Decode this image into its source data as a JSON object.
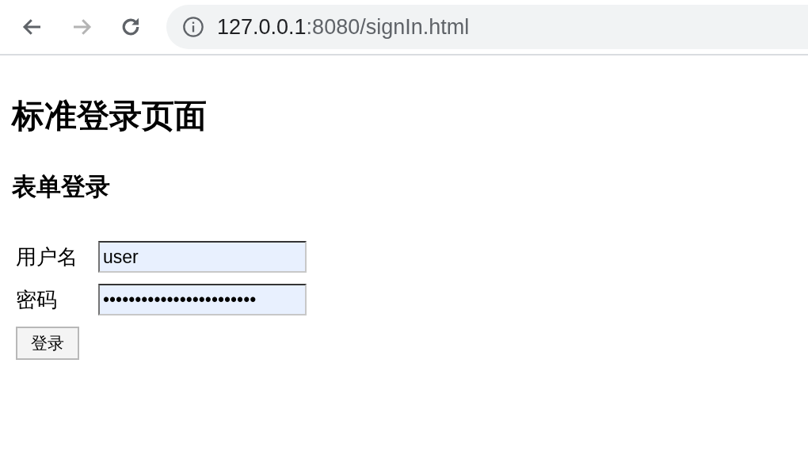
{
  "browser": {
    "nav_buttons": [
      {
        "kind": "back",
        "disabled": false
      },
      {
        "kind": "forward",
        "disabled": true
      },
      {
        "kind": "reload",
        "disabled": false
      }
    ],
    "url_host": "127.0.0.1",
    "url_rest": ":8080/signIn.html"
  },
  "page": {
    "title": "标准登录页面",
    "subtitle": "表单登录",
    "fields": [
      {
        "label": "用户名",
        "value": "user"
      },
      {
        "label": "密码",
        "value": "••••••••••••••••••••••••"
      }
    ],
    "button": "登录"
  }
}
